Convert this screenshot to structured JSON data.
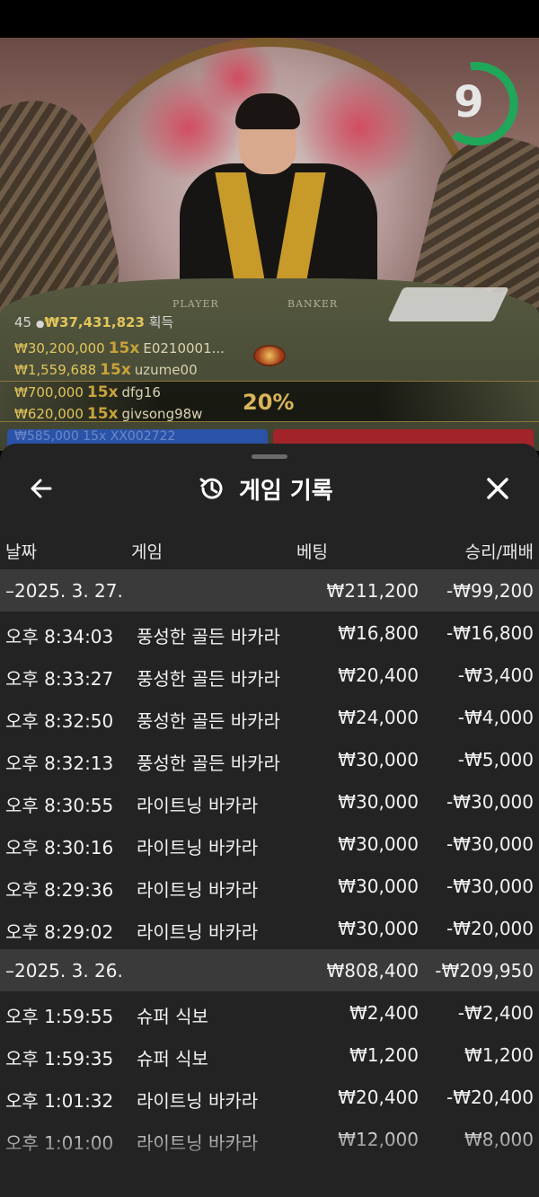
{
  "video": {
    "timer": "9",
    "felt_labels": {
      "player": "PLAYER",
      "banker": "BANKER"
    },
    "stats": {
      "count": "45",
      "total": "₩37,431,823",
      "suffix": "획득"
    },
    "winners": [
      {
        "amount": "₩30,200,000",
        "mult": "15x",
        "name": "E0210001..."
      },
      {
        "amount": "₩1,559,688",
        "mult": "15x",
        "name": "uzume00"
      },
      {
        "amount": "₩700,000",
        "mult": "15x",
        "name": "dfg16"
      },
      {
        "amount": "₩620,000",
        "mult": "15x",
        "name": "givsong98w"
      }
    ],
    "percent": "20%",
    "bet_strip_text": "₩585,000 15x XX002722"
  },
  "sheet": {
    "title": "게임 기록",
    "columns": {
      "date": "날짜",
      "game": "게임",
      "bet": "베팅",
      "result": "승리/패배"
    },
    "rows": [
      {
        "type": "date",
        "time": "–2025. 3. 27.",
        "bet": "₩211,200",
        "result": "-₩99,200"
      },
      {
        "type": "entry",
        "time": "오후 8:34:03",
        "game": "풍성한 골든 바카라",
        "bet": "₩16,800",
        "result": "-₩16,800"
      },
      {
        "type": "entry",
        "time": "오후 8:33:27",
        "game": "풍성한 골든 바카라",
        "bet": "₩20,400",
        "result": "-₩3,400"
      },
      {
        "type": "entry",
        "time": "오후 8:32:50",
        "game": "풍성한 골든 바카라",
        "bet": "₩24,000",
        "result": "-₩4,000"
      },
      {
        "type": "entry",
        "time": "오후 8:32:13",
        "game": "풍성한 골든 바카라",
        "bet": "₩30,000",
        "result": "-₩5,000"
      },
      {
        "type": "entry",
        "time": "오후 8:30:55",
        "game": "라이트닝 바카라",
        "bet": "₩30,000",
        "result": "-₩30,000"
      },
      {
        "type": "entry",
        "time": "오후 8:30:16",
        "game": "라이트닝 바카라",
        "bet": "₩30,000",
        "result": "-₩30,000"
      },
      {
        "type": "entry",
        "time": "오후 8:29:36",
        "game": "라이트닝 바카라",
        "bet": "₩30,000",
        "result": "-₩30,000"
      },
      {
        "type": "entry",
        "time": "오후 8:29:02",
        "game": "라이트닝 바카라",
        "bet": "₩30,000",
        "result": "-₩20,000"
      },
      {
        "type": "date",
        "time": "–2025. 3. 26.",
        "bet": "₩808,400",
        "result": "-₩209,950"
      },
      {
        "type": "entry",
        "time": "오후 1:59:55",
        "game": "슈퍼 식보",
        "bet": "₩2,400",
        "result": "-₩2,400"
      },
      {
        "type": "entry",
        "time": "오후 1:59:35",
        "game": "슈퍼 식보",
        "bet": "₩1,200",
        "result": "₩1,200"
      },
      {
        "type": "entry",
        "time": "오후 1:01:32",
        "game": "라이트닝 바카라",
        "bet": "₩20,400",
        "result": "-₩20,400"
      },
      {
        "type": "entry",
        "time": "오후 1:01:00",
        "game": "라이트닝 바카라",
        "bet": "₩12,000",
        "result": "₩8,000"
      }
    ]
  }
}
